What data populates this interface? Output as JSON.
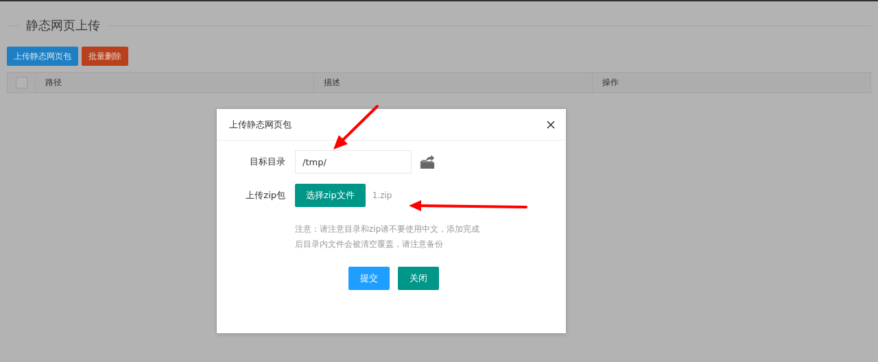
{
  "page": {
    "title": "静态网页上传"
  },
  "toolbar": {
    "buttons": [
      {
        "label": "上传静态网页包",
        "kind": "primary"
      },
      {
        "label": "批量删除",
        "kind": "danger"
      }
    ]
  },
  "table": {
    "select_all": {
      "checked": false
    },
    "columns": [
      "路径",
      "描述",
      "操作"
    ]
  },
  "dialog": {
    "title": "上传静态网页包",
    "fields": [
      {
        "label": "目标目录",
        "kind": "text",
        "value": "/tmp/"
      },
      {
        "label": "上传zip包",
        "kind": "file",
        "button": "选择zip文件",
        "file_name": "1.zip"
      }
    ],
    "note": "注意：请注意目录和zip请不要使用中文，添加完成后目录内文件会被清空覆盖，请注意备份",
    "buttons": [
      {
        "label": "提交",
        "kind": "primary"
      },
      {
        "label": "关闭",
        "kind": "secondary"
      }
    ]
  }
}
